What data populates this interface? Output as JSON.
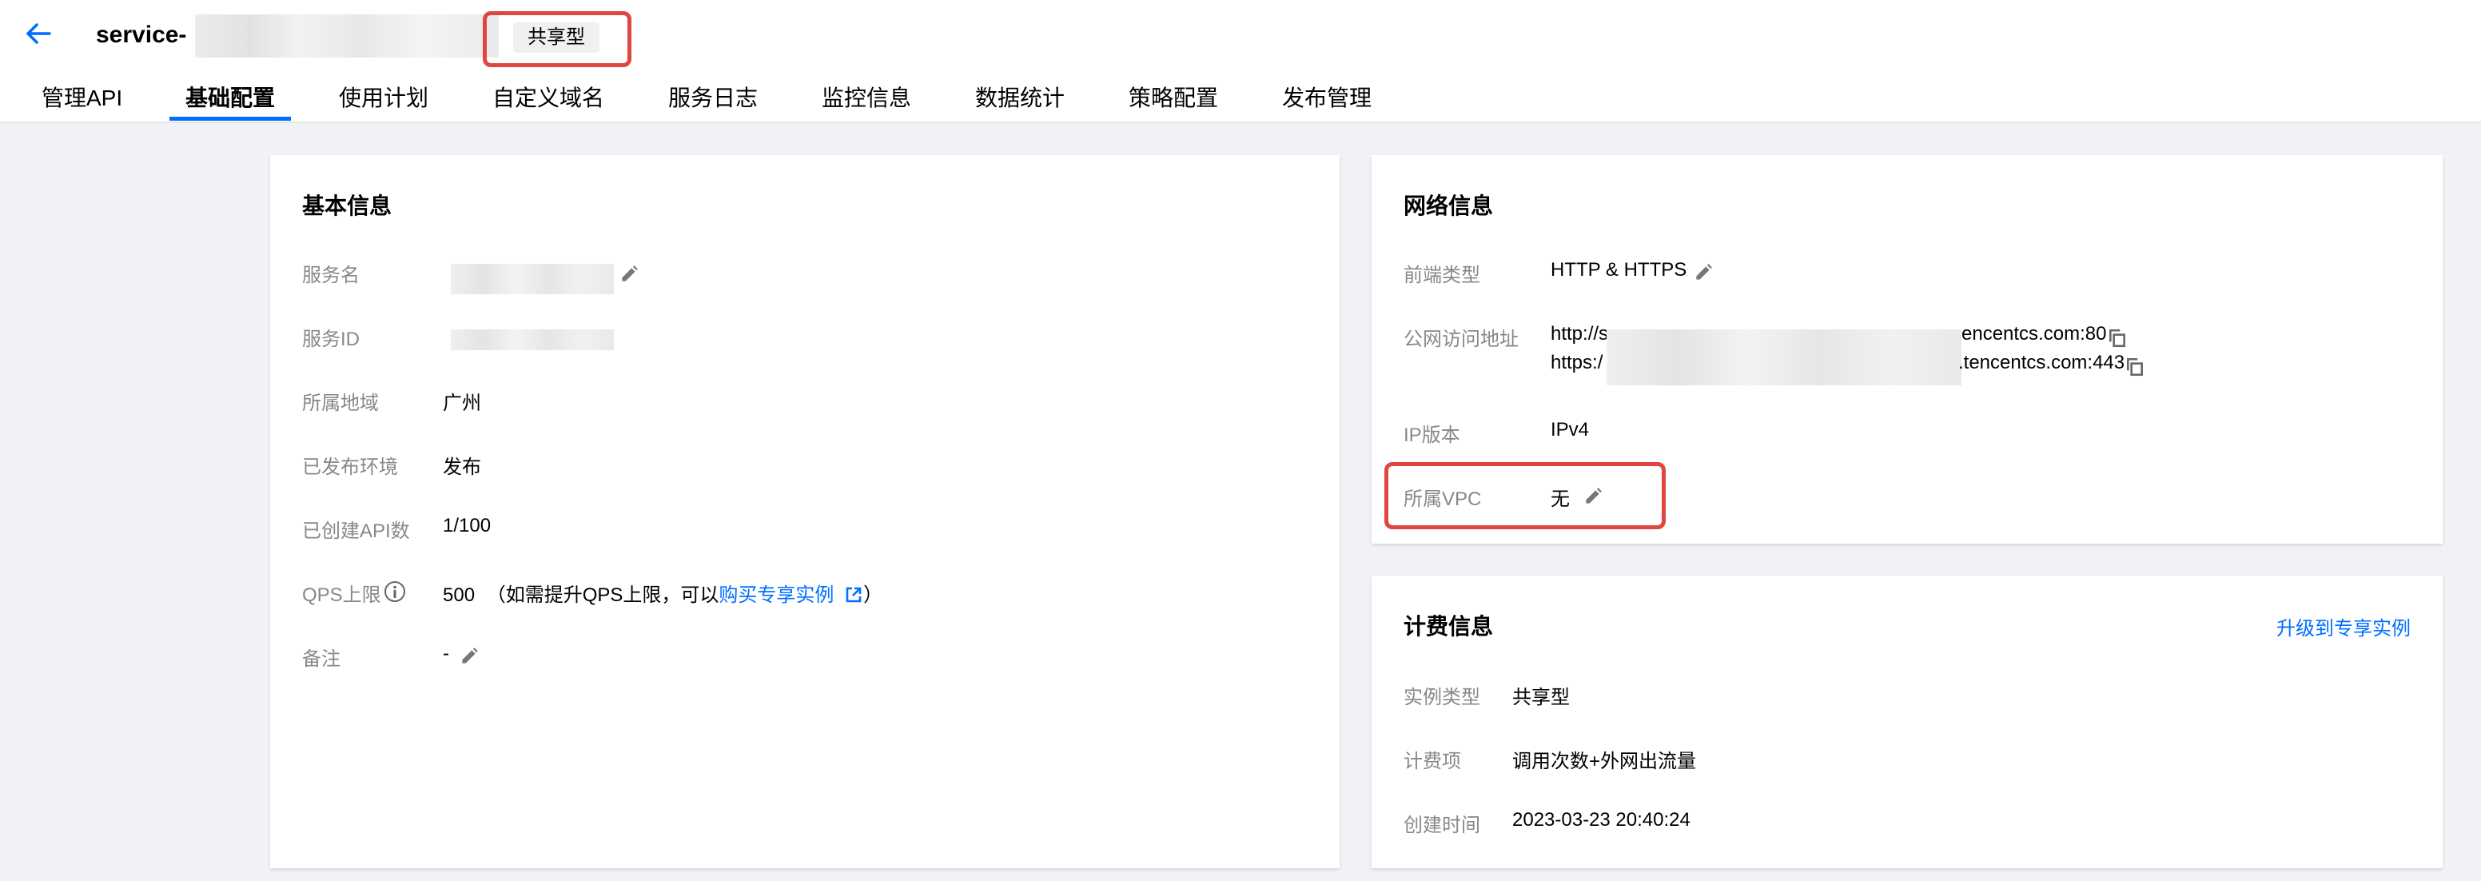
{
  "header": {
    "back_icon": "arrow-left-icon",
    "service_title": "service-",
    "instance_type_badge": "共享型"
  },
  "tabs": [
    {
      "label": "管理API"
    },
    {
      "label": "基础配置",
      "active": true
    },
    {
      "label": "使用计划"
    },
    {
      "label": "自定义域名"
    },
    {
      "label": "服务日志"
    },
    {
      "label": "监控信息"
    },
    {
      "label": "数据统计"
    },
    {
      "label": "策略配置"
    },
    {
      "label": "发布管理"
    }
  ],
  "basic_info": {
    "title": "基本信息",
    "service_name_label": "服务名",
    "service_id_label": "服务ID",
    "region_label": "所属地域",
    "region_value": "广州",
    "env_label": "已发布环境",
    "env_value": "发布",
    "api_count_label": "已创建API数",
    "api_count_value": "1/100",
    "qps_label": "QPS上限",
    "qps_value": "500",
    "qps_note_prefix": "（如需提升QPS上限，可以",
    "qps_note_link": "购买专享实例",
    "qps_note_suffix": "）",
    "remark_label": "备注",
    "remark_value": "-"
  },
  "network_info": {
    "title": "网络信息",
    "frontend_type_label": "前端类型",
    "frontend_type_value": "HTTP & HTTPS",
    "public_address_label": "公网访问地址",
    "http_prefix": "http://s",
    "http_suffix": "encentcs.com:80",
    "https_prefix": "https:/",
    "https_suffix": ".tencentcs.com:443",
    "ip_version_label": "IP版本",
    "ip_version_value": "IPv4",
    "vpc_label": "所属VPC",
    "vpc_value": "无"
  },
  "billing_info": {
    "title": "计费信息",
    "upgrade_link": "升级到专享实例",
    "instance_type_label": "实例类型",
    "instance_type_value": "共享型",
    "billing_item_label": "计费项",
    "billing_item_value": "调用次数+外网出流量",
    "created_time_label": "创建时间",
    "created_time_value": "2023-03-23 20:40:24"
  },
  "colors": {
    "accent": "#006eff",
    "highlight_box": "#e0453f",
    "label_gray": "#888888",
    "page_bg": "#f1f2f5"
  }
}
